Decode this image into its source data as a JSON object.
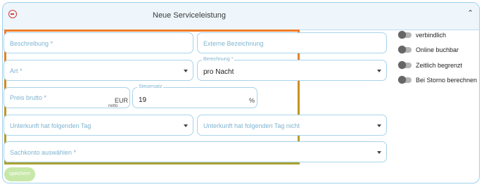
{
  "panel": {
    "title": "Neue Serviceleistung"
  },
  "form": {
    "beschreibung": {
      "placeholder": "Beschreibung *"
    },
    "externe_bezeichnung": {
      "placeholder": "Externe Bezeichnung"
    },
    "art": {
      "placeholder": "Art *"
    },
    "berechnung": {
      "label": "Berechnung *",
      "value": "pro Nacht"
    },
    "preis_brutto": {
      "placeholder": "Preis brutto *",
      "currency": "EUR",
      "suffix_note": "netto"
    },
    "steuersatz": {
      "label": "Steuersatz",
      "value": "19",
      "unit": "%"
    },
    "unterkunft_tag": {
      "placeholder": "Unterkunft hat folgenden Tag"
    },
    "unterkunft_tag_nicht": {
      "placeholder": "Unterkunft hat folgenden Tag nicht"
    },
    "sachkonto": {
      "placeholder": "Sachkonto auswählen *"
    }
  },
  "toggles": [
    {
      "label": "verbindlich"
    },
    {
      "label": "Online buchbar"
    },
    {
      "label": "Zeitlich begrenzt"
    },
    {
      "label": "Bei Storno berechnen"
    }
  ],
  "actions": {
    "save_label": "speichern"
  },
  "colors": {
    "border": "#a9d3ea",
    "placeholder": "#7fb4d1",
    "highlight": "#f07b2a",
    "save_button": "#c7e8a8"
  }
}
